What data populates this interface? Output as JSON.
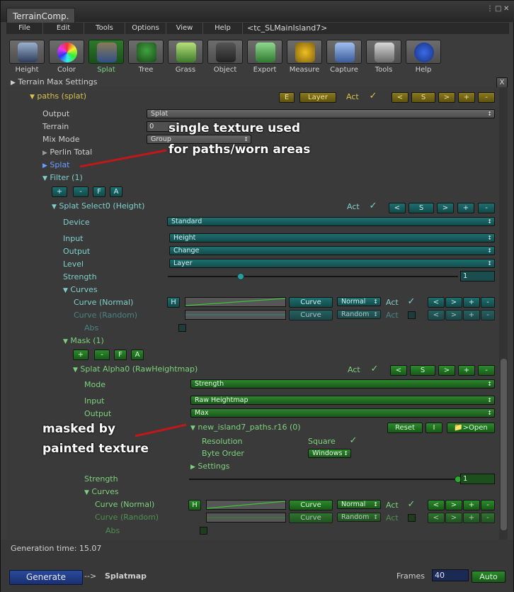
{
  "window": {
    "tab_title": "TerrainComp.",
    "controls": [
      "⋮",
      "□",
      "✕"
    ]
  },
  "menu": {
    "items": [
      "File",
      "Edit",
      "Tools",
      "Options",
      "View",
      "Help"
    ],
    "title": "<tc_SLMainIsland7>"
  },
  "toolbar": {
    "items": [
      {
        "label": "Height",
        "icon": "height-icon",
        "selected": false
      },
      {
        "label": "Color",
        "icon": "color-wheel-icon",
        "selected": false
      },
      {
        "label": "Splat",
        "icon": "splat-icon",
        "selected": true
      },
      {
        "label": "Tree",
        "icon": "tree-icon",
        "selected": false
      },
      {
        "label": "Grass",
        "icon": "grass-icon",
        "selected": false
      },
      {
        "label": "Object",
        "icon": "object-icon",
        "selected": false
      },
      {
        "label": "Export",
        "icon": "export-icon",
        "selected": false
      },
      {
        "label": "Measure",
        "icon": "tape-measure-icon",
        "selected": false
      },
      {
        "label": "Capture",
        "icon": "camera-icon",
        "selected": false
      },
      {
        "label": "Tools",
        "icon": "tools-icon",
        "selected": false
      },
      {
        "label": "Help",
        "icon": "help-icon",
        "selected": false
      }
    ]
  },
  "terrain_max_settings": "Terrain Max Settings",
  "close_x": "X",
  "paths": {
    "label": "paths (splat)",
    "buttons": [
      "E",
      "Layer"
    ],
    "act_label": "Act",
    "nav": [
      "<",
      "S",
      ">",
      "+",
      "-"
    ],
    "output_label": "Output",
    "output_value": "Splat",
    "terrain_label": "Terrain",
    "terrain_value": "0",
    "mixmode_label": "Mix Mode",
    "mixmode_value": "Group",
    "perlin_label": "Perlin Total",
    "splat_label": "Splat",
    "filter_label": "Filter (1)",
    "filter_buttons": [
      "+",
      "-",
      "F",
      "A"
    ]
  },
  "splat_select": {
    "label": "Splat Select0 (Height)",
    "act_label": "Act",
    "nav": [
      "<",
      "S",
      ">",
      "+",
      "-"
    ],
    "device_label": "Device",
    "device_value": "Standard",
    "input_label": "Input",
    "input_value": "Height",
    "output_label": "Output",
    "output_value": "Change",
    "level_label": "Level",
    "level_value": "Layer",
    "strength_label": "Strength",
    "strength_value": "1",
    "strength_fraction": 0.25,
    "curves_label": "Curves",
    "curve_normal": {
      "label": "Curve (Normal)",
      "h": "H",
      "curve_btn": "Curve",
      "mode": "Normal",
      "act": "Act",
      "nav": [
        "<",
        ">",
        "+",
        "-"
      ]
    },
    "curve_random": {
      "label": "Curve (Random)",
      "curve_btn": "Curve",
      "mode": "Random",
      "act": "Act",
      "nav": [
        "<",
        ">",
        "+",
        "-"
      ]
    },
    "abs_label": "Abs"
  },
  "mask": {
    "label": "Mask (1)",
    "buttons": [
      "+",
      "-",
      "F",
      "A"
    ],
    "alpha": {
      "label": "Splat Alpha0 (RawHeightmap)",
      "act_label": "Act",
      "nav": [
        "<",
        "S",
        ">",
        "+",
        "-"
      ],
      "mode_label": "Mode",
      "mode_value": "Strength",
      "input_label": "Input",
      "input_value": "Raw Heightmap",
      "output_label": "Output",
      "output_value": "Max",
      "file_label": "new_island7_paths.r16 (0)",
      "reset_btn": "Reset",
      "i_btn": "I",
      "open_btn": ">Open",
      "resolution_label": "Resolution",
      "resolution_value": "Square",
      "byteorder_label": "Byte Order",
      "byteorder_value": "Windows",
      "settings_label": "Settings",
      "strength_label": "Strength",
      "strength_value": "1",
      "strength_fraction": 1.0,
      "curves_label": "Curves",
      "curve_normal": {
        "label": "Curve (Normal)",
        "h": "H",
        "curve_btn": "Curve",
        "mode": "Normal",
        "act": "Act",
        "nav": [
          "<",
          ">",
          "+",
          "-"
        ]
      },
      "curve_random": {
        "label": "Curve (Random)",
        "curve_btn": "Curve",
        "mode": "Random",
        "act": "Act",
        "nav": [
          "<",
          ">",
          "+",
          "-"
        ]
      },
      "abs_label": "Abs"
    }
  },
  "annotations": {
    "note1_line1": "single texture used",
    "note1_line2": "for paths/worn areas",
    "note2_line1": "masked by",
    "note2_line2": "painted texture"
  },
  "bottom": {
    "generation_time": "Generation time: 15.07",
    "generate_btn": "Generate",
    "arrow": "-->",
    "target": "Splatmap",
    "frames_label": "Frames",
    "frames_value": "40",
    "auto_btn": "Auto"
  },
  "colors": {
    "green_accent": "#7cd27c",
    "teal_accent": "#7fd0cc",
    "yellow_accent": "#d6c24a",
    "selected_tool": "#2d7a2d",
    "annotation_arrow": "#c01818"
  }
}
